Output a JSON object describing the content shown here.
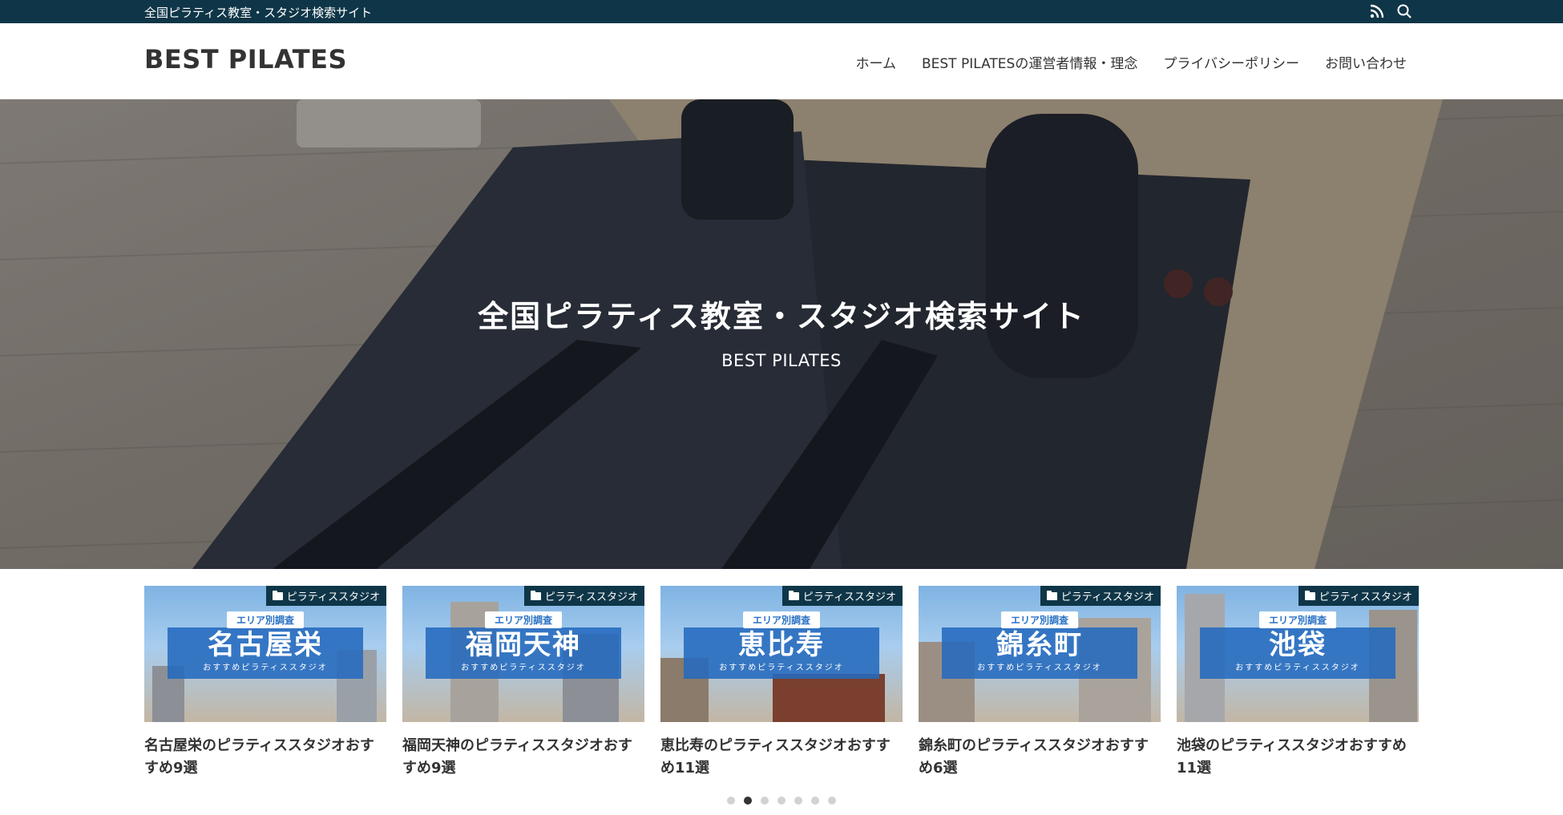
{
  "topbar": {
    "tagline": "全国ピラティス教室・スタジオ検索サイト",
    "icons": [
      "rss-icon",
      "search-icon"
    ]
  },
  "header": {
    "logo": "BEST PILATES",
    "nav": [
      {
        "label": "ホーム"
      },
      {
        "label": "BEST PILATESの運営者情報・理念"
      },
      {
        "label": "プライバシーポリシー"
      },
      {
        "label": "お問い合わせ"
      }
    ]
  },
  "hero": {
    "title": "全国ピラティス教室・スタジオ検索サイト",
    "subtitle": "BEST PILATES"
  },
  "cards": [
    {
      "category": "ピラティススタジオ",
      "badge": "エリア別調査",
      "place": "名古屋栄",
      "band_sub": "おすすめピラティススタジオ",
      "title": "名古屋栄のピラティススタジオおすすめ9選"
    },
    {
      "category": "ピラティススタジオ",
      "badge": "エリア別調査",
      "place": "福岡天神",
      "band_sub": "おすすめピラティススタジオ",
      "title": "福岡天神のピラティススタジオおすすめ9選"
    },
    {
      "category": "ピラティススタジオ",
      "badge": "エリア別調査",
      "place": "恵比寿",
      "band_sub": "おすすめピラティススタジオ",
      "title": "恵比寿のピラティススタジオおすすめ11選"
    },
    {
      "category": "ピラティススタジオ",
      "badge": "エリア別調査",
      "place": "錦糸町",
      "band_sub": "おすすめピラティススタジオ",
      "title": "錦糸町のピラティススタジオおすすめ6選"
    },
    {
      "category": "ピラティススタジオ",
      "badge": "エリア別調査",
      "place": "池袋",
      "band_sub": "おすすめピラティススタジオ",
      "title": "池袋のピラティススタジオおすすめ11選"
    }
  ],
  "carousel": {
    "dot_count": 7,
    "active_index": 1
  },
  "colors": {
    "topbar": "#0f3648",
    "band": "#246abe"
  }
}
